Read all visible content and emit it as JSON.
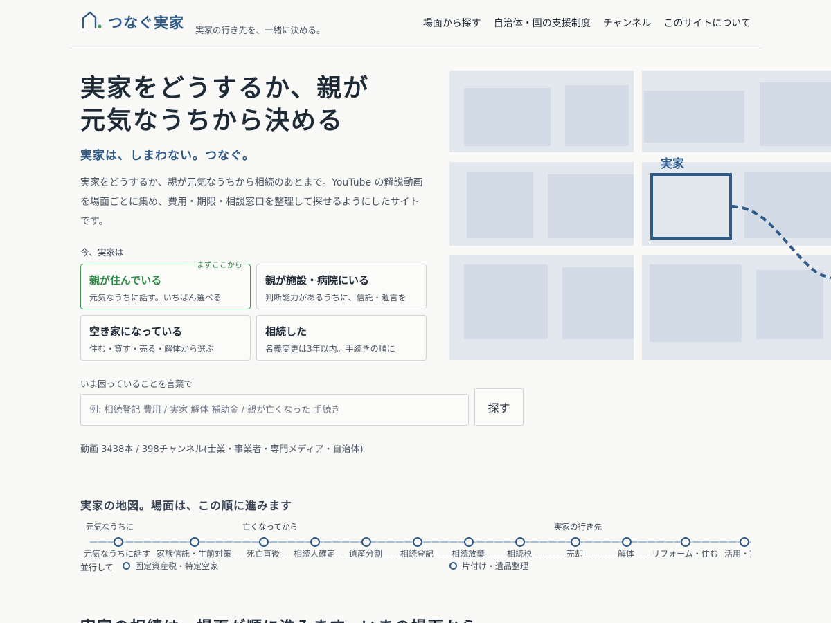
{
  "header": {
    "logo": "つなぐ実家",
    "tagline": "実家の行き先を、一緒に決める。",
    "nav": [
      "場面から探す",
      "自治体・国の支援制度",
      "チャンネル",
      "このサイトについて"
    ]
  },
  "hero": {
    "title": "実家をどうするか、親が元気なうちから決める",
    "subtitle": "実家は、しまわない。つなぐ。",
    "description": "実家をどうするか、親が元気なうちから相続のあとまで。YouTube の解説動画を場面ごとに集め、費用・期限・相談窓口を整理して探せるようにしたサイトです。"
  },
  "situation": {
    "label": "今、実家は",
    "cards": [
      {
        "title": "親が住んでいる",
        "desc": "元気なうちに話す。いちばん選べる",
        "tag": "まずここから"
      },
      {
        "title": "親が施設・病院にいる",
        "desc": "判断能力があるうちに、信託・遺言を"
      },
      {
        "title": "空き家になっている",
        "desc": "住む・貸す・売る・解体から選ぶ"
      },
      {
        "title": "相続した",
        "desc": "名義変更は3年以内。手続きの順に"
      }
    ]
  },
  "search": {
    "label": "いま困っていることを言葉で",
    "placeholder": "例: 相続登記 費用 / 実家 解体 補助金 / 親が亡くなった 手続き",
    "button": "探す"
  },
  "stats": "動画 3438本 / 398チャンネル(士業・事業者・専門メディア・自治体)",
  "map": {
    "label": "実家",
    "colors": {
      "bg": "#e3e8ef",
      "block": "#d3dce6",
      "highlight": "#2f5a87"
    }
  },
  "timeline": {
    "title": "実家の地図。場面は、この順に進みます",
    "groups": [
      "元気なうちに",
      "亡くなってから",
      "実家の行き先"
    ],
    "steps": [
      "元気なうちに話す",
      "家族信託・生前対策",
      "死亡直後",
      "相続人確定",
      "遺産分割",
      "相続登記",
      "相続放棄",
      "相続税",
      "売却",
      "解体",
      "リフォーム・住む",
      "活用・貸す"
    ],
    "parallel_label": "並行して",
    "parallel": [
      "固定資産税・特定空家",
      "片付け・遺品整理"
    ]
  },
  "bottom_heading": "実家の相続は、場面が順に進みます。いまの場面から"
}
